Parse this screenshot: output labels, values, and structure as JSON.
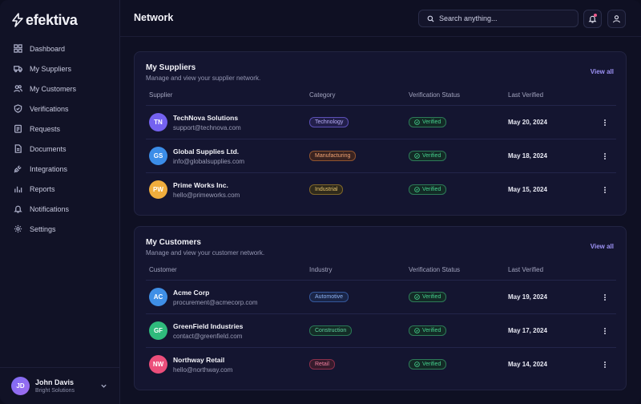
{
  "brand": {
    "name": "efektiva"
  },
  "sidebar": {
    "items": [
      {
        "label": "Dashboard",
        "icon": "grid-icon"
      },
      {
        "label": "My Suppliers",
        "icon": "truck-icon"
      },
      {
        "label": "My Customers",
        "icon": "users-icon"
      },
      {
        "label": "Verifications",
        "icon": "shield-check-icon"
      },
      {
        "label": "Requests",
        "icon": "clipboard-icon"
      },
      {
        "label": "Documents",
        "icon": "document-icon"
      },
      {
        "label": "Integrations",
        "icon": "plug-icon"
      },
      {
        "label": "Reports",
        "icon": "bar-chart-icon"
      },
      {
        "label": "Notifications",
        "icon": "bell-icon"
      },
      {
        "label": "Settings",
        "icon": "gear-icon"
      }
    ]
  },
  "user": {
    "initials": "JD",
    "name": "John Davis",
    "org": "Bright Solutions"
  },
  "header": {
    "title": "Network",
    "search_placeholder": "Search anything..."
  },
  "colors": {
    "accent": "#9d92f5",
    "verified": "#45d08d",
    "notification_dot": "#ef5a8c"
  },
  "suppliers": {
    "title": "My Suppliers",
    "subtitle": "Manage and view your supplier network.",
    "view_all": "View all",
    "columns": [
      "Supplier",
      "Category",
      "Verification Status",
      "Last Verified"
    ],
    "rows": [
      {
        "initials": "TN",
        "name": "TechNova Solutions",
        "email": "support@technova.com",
        "tag": "Technology",
        "status": "Verified",
        "date": "May 20, 2024"
      },
      {
        "initials": "GS",
        "name": "Global Supplies Ltd.",
        "email": "info@globalsupplies.com",
        "tag": "Manufacturing",
        "status": "Verified",
        "date": "May 18, 2024"
      },
      {
        "initials": "PW",
        "name": "Prime Works Inc.",
        "email": "hello@primeworks.com",
        "tag": "Industrial",
        "status": "Verified",
        "date": "May 15, 2024"
      }
    ]
  },
  "customers": {
    "title": "My Customers",
    "subtitle": "Manage and view your customer network.",
    "view_all": "View all",
    "columns": [
      "Customer",
      "Industry",
      "Verification Status",
      "Last Verified"
    ],
    "rows": [
      {
        "initials": "AC",
        "name": "Acme Corp",
        "email": "procurement@acmecorp.com",
        "tag": "Automotive",
        "status": "Verified",
        "date": "May 19, 2024"
      },
      {
        "initials": "GF",
        "name": "GreenField Industries",
        "email": "contact@greenfield.com",
        "tag": "Construction",
        "status": "Verified",
        "date": "May 17, 2024"
      },
      {
        "initials": "NW",
        "name": "Northway Retail",
        "email": "hello@northway.com",
        "tag": "Retail",
        "status": "Verified",
        "date": "May 14, 2024"
      }
    ]
  }
}
